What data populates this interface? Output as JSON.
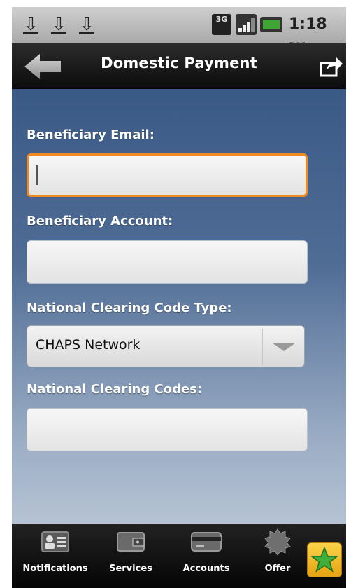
{
  "status_bar": {
    "network": "3G",
    "time": "1:18",
    "ampm": "PM"
  },
  "header": {
    "title": "Domestic Payment"
  },
  "form": {
    "beneficiary_email_label": "Beneficiary Email:",
    "beneficiary_email_value": "",
    "beneficiary_account_label": "Beneficiary Account:",
    "beneficiary_account_value": "",
    "clearing_code_type_label": "National Clearing Code Type:",
    "clearing_code_type_value": "CHAPS Network",
    "clearing_codes_label": "National Clearing Codes:",
    "clearing_codes_value": ""
  },
  "tabs": [
    {
      "label": "Notifications",
      "icon": "contact-card-icon"
    },
    {
      "label": "Services",
      "icon": "wallet-icon"
    },
    {
      "label": "Accounts",
      "icon": "credit-card-icon"
    },
    {
      "label": "Offer",
      "icon": "offer-badge-icon"
    }
  ],
  "colors": {
    "focus_border": "#f08a1c",
    "content_top": "#3a5a86",
    "content_bottom": "#b6c3d4",
    "favorite_star": "#3fae3a"
  }
}
